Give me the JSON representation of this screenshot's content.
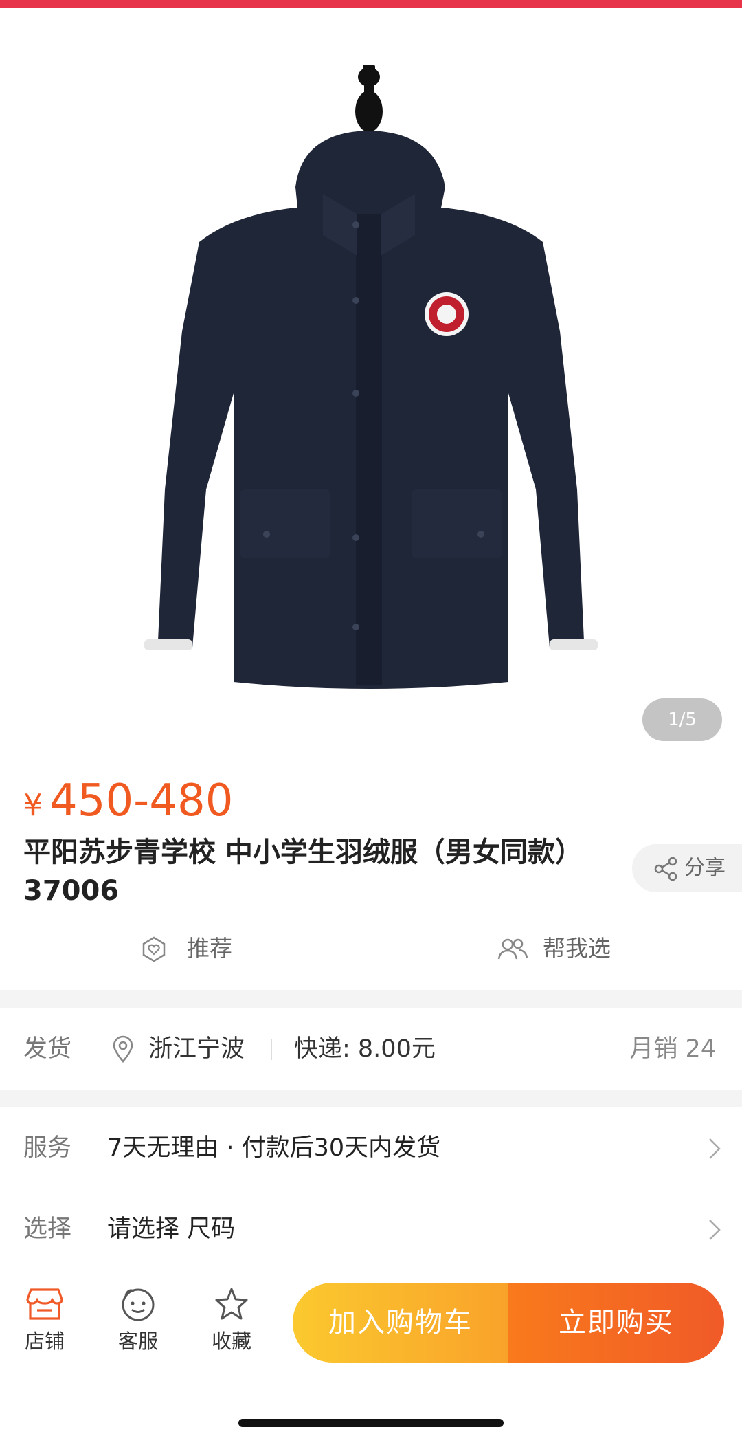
{
  "gallery": {
    "counter": "1/5"
  },
  "product": {
    "currency": "¥",
    "price": "450-480",
    "title": "平阳苏步青学校  中小学生羽绒服（男女同款） 37006",
    "share_label": "分享",
    "recommend_label": "推荐",
    "help_choose_label": "帮我选"
  },
  "shipping": {
    "label": "发货",
    "location": "浙江宁波",
    "express": "快递: 8.00元",
    "monthly_sales": "月销 24"
  },
  "service": {
    "label": "服务",
    "value": "7天无理由 · 付款后30天内发货"
  },
  "select": {
    "label": "选择",
    "value": "请选择 尺码"
  },
  "bottom_bar": {
    "store_label": "店铺",
    "service_label": "客服",
    "favorite_label": "收藏",
    "add_cart_label": "加入购物车",
    "buy_now_label": "立即购买"
  },
  "colors": {
    "accent": "#f0591f",
    "top_bar": "#e8344a",
    "cart": "#fbc92f",
    "buy": "#f05a28"
  }
}
